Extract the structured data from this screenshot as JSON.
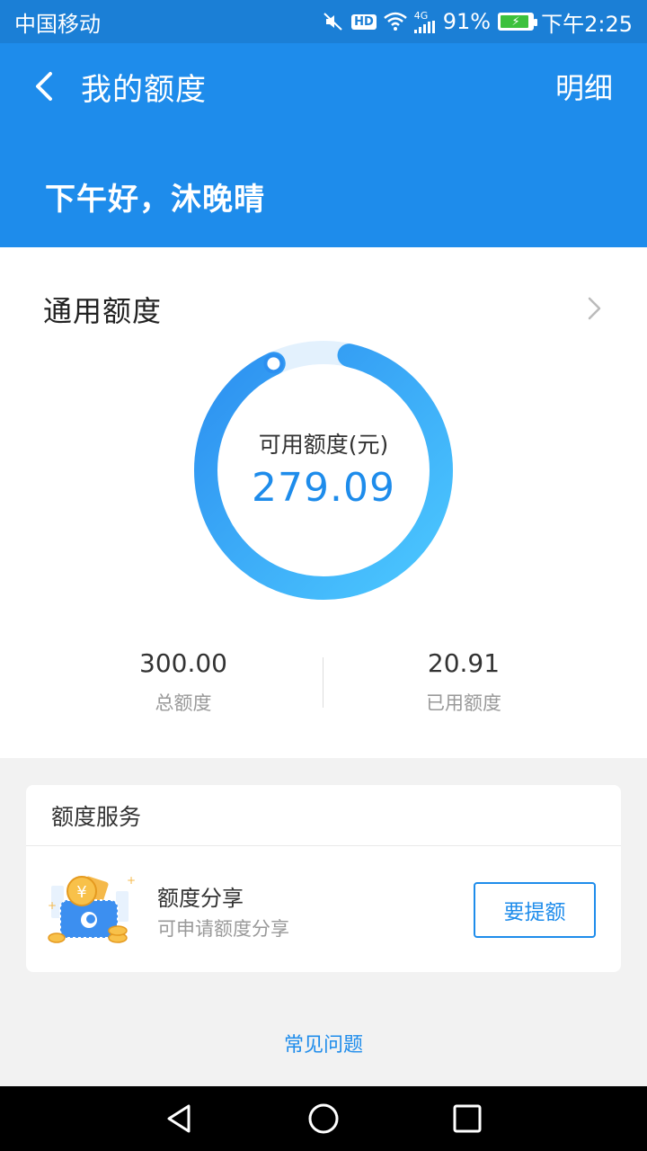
{
  "status_bar": {
    "carrier": "中国移动",
    "network": "4G",
    "hd_badge": "HD",
    "battery": "91%",
    "battery_level": 0.91,
    "time": "下午2:25"
  },
  "header": {
    "title": "我的额度",
    "detail_label": "明细",
    "greeting": "下午好，沐晚晴"
  },
  "general_credit": {
    "section_title": "通用额度",
    "available_label": "可用额度(元)",
    "available_value": "279.09",
    "available_fraction": 0.9303,
    "total_value": "300.00",
    "total_label": "总额度",
    "used_value": "20.91",
    "used_label": "已用额度"
  },
  "credit_service": {
    "section_title": "额度服务",
    "item_name": "额度分享",
    "item_desc": "可申请额度分享",
    "button_label": "要提额"
  },
  "footer": {
    "faq_label": "常见问题"
  },
  "colors": {
    "brand_blue": "#1e8ceb",
    "status_bar_blue": "#1b7fd6",
    "ring_start": "#4cc8ff",
    "ring_end": "#2c8ff0",
    "ring_track": "#e3f1fd"
  }
}
